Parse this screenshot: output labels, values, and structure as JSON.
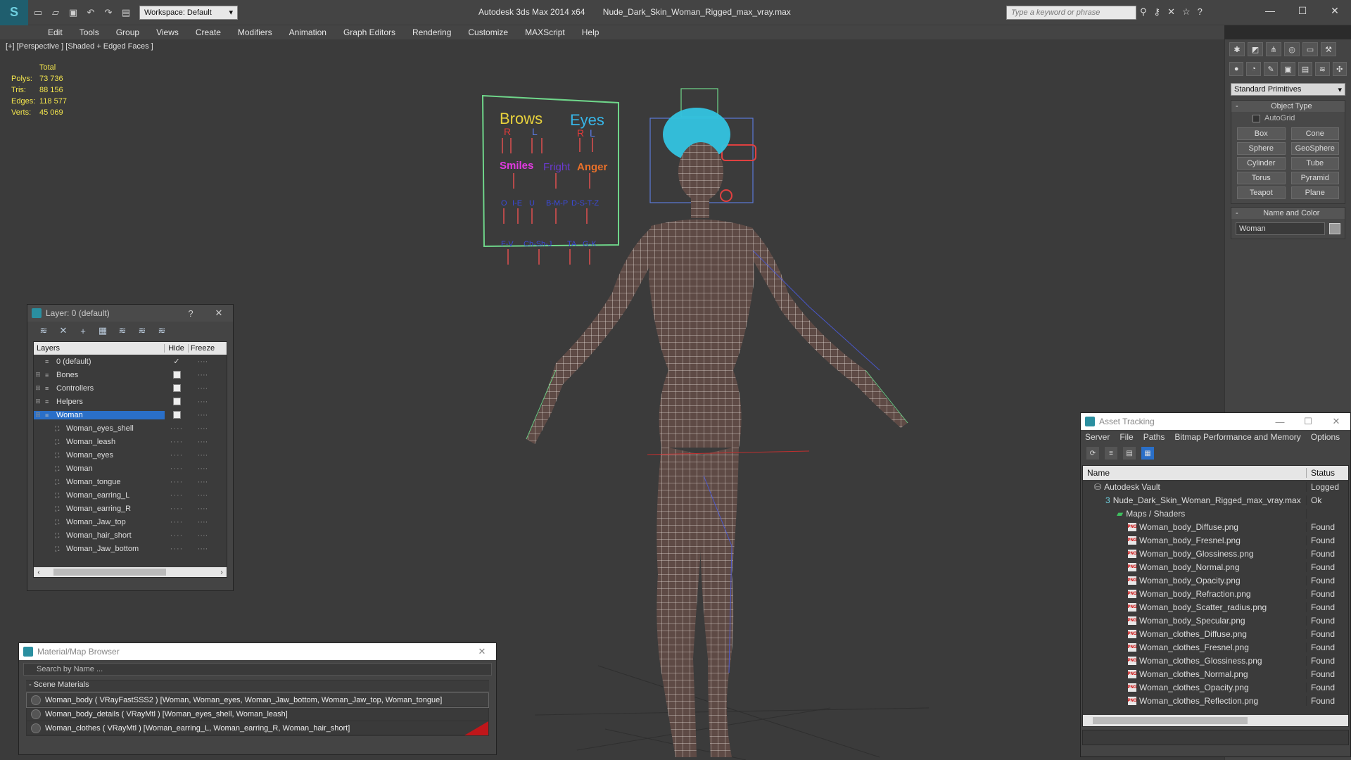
{
  "titlebar": {
    "workspace_label": "Workspace: Default",
    "app_title": "Autodesk 3ds Max  2014 x64",
    "file_title": "Nude_Dark_Skin_Woman_Rigged_max_vray.max",
    "search_placeholder": "Type a keyword or phrase"
  },
  "menu": [
    "Edit",
    "Tools",
    "Group",
    "Views",
    "Create",
    "Modifiers",
    "Animation",
    "Graph Editors",
    "Rendering",
    "Customize",
    "MAXScript",
    "Help"
  ],
  "viewport": {
    "label": "[+] [Perspective ] [Shaded + Edged Faces ]",
    "stats_header": "Total",
    "stats": [
      {
        "label": "Polys:",
        "value": "73 736"
      },
      {
        "label": "Tris:",
        "value": "88 156"
      },
      {
        "label": "Edges:",
        "value": "118 577"
      },
      {
        "label": "Verts:",
        "value": "45 069"
      }
    ],
    "face_rig": {
      "brows": "Brows",
      "eyes": "Eyes",
      "r": "R",
      "l": "L",
      "smiles": "Smiles",
      "fright": "Fright",
      "anger": "Anger",
      "row3": [
        "O",
        "I-E",
        "U",
        "B-M-P",
        "D-S-T-Z"
      ],
      "row4": [
        "F-V",
        "Ch-Sh-J",
        "TA",
        "G-K"
      ]
    },
    "colors": {
      "mesh": "#ffffff",
      "skin": "#5e4a45",
      "hair": "#33c3e0",
      "rig_green": "#6fd68a"
    }
  },
  "command_panel": {
    "dropdown": "Standard Primitives",
    "object_type_title": "Object Type",
    "autogrid": "AutoGrid",
    "buttons": [
      "Box",
      "Cone",
      "Sphere",
      "GeoSphere",
      "Cylinder",
      "Tube",
      "Torus",
      "Pyramid",
      "Teapot",
      "Plane"
    ],
    "name_color_title": "Name and Color",
    "name_value": "Woman"
  },
  "layer_panel": {
    "title": "Layer: 0 (default)",
    "help": "?",
    "col_layers": "Layers",
    "col_hide": "Hide",
    "col_freeze": "Freeze",
    "rows": [
      {
        "name": "0 (default)",
        "level": 0,
        "check": true
      },
      {
        "name": "Bones",
        "level": 0
      },
      {
        "name": "Controllers",
        "level": 0
      },
      {
        "name": "Helpers",
        "level": 0
      },
      {
        "name": "Woman",
        "level": 0,
        "selected": true
      },
      {
        "name": "Woman_eyes_shell",
        "level": 1
      },
      {
        "name": "Woman_leash",
        "level": 1
      },
      {
        "name": "Woman_eyes",
        "level": 1
      },
      {
        "name": "Woman",
        "level": 1
      },
      {
        "name": "Woman_tongue",
        "level": 1
      },
      {
        "name": "Woman_earring_L",
        "level": 1
      },
      {
        "name": "Woman_earring_R",
        "level": 1
      },
      {
        "name": "Woman_Jaw_top",
        "level": 1
      },
      {
        "name": "Woman_hair_short",
        "level": 1
      },
      {
        "name": "Woman_Jaw_bottom",
        "level": 1
      }
    ]
  },
  "material_browser": {
    "title": "Material/Map Browser",
    "search_placeholder": "Search by Name ...",
    "section": "- Scene Materials",
    "items": [
      "Woman_body  ( VRayFastSSS2 ) [Woman, Woman_eyes, Woman_Jaw_bottom, Woman_Jaw_top, Woman_tongue]",
      "Woman_body_details  ( VRayMtl ) [Woman_eyes_shell, Woman_leash]",
      "Woman_clothes  ( VRayMtl ) [Woman_earring_L, Woman_earring_R, Woman_hair_short]"
    ]
  },
  "asset_tracking": {
    "title": "Asset Tracking",
    "menu": [
      "Server",
      "File",
      "Paths",
      "Bitmap Performance and Memory",
      "Options"
    ],
    "col_name": "Name",
    "col_status": "Status",
    "rows": [
      {
        "name": "Autodesk Vault",
        "status": "Logged",
        "level": 1,
        "icon": "vault"
      },
      {
        "name": "Nude_Dark_Skin_Woman_Rigged_max_vray.max",
        "status": "Ok",
        "level": 2,
        "icon": "max"
      },
      {
        "name": "Maps / Shaders",
        "status": "",
        "level": 3,
        "icon": "folder"
      },
      {
        "name": "Woman_body_Diffuse.png",
        "status": "Found",
        "level": 4,
        "icon": "png"
      },
      {
        "name": "Woman_body_Fresnel.png",
        "status": "Found",
        "level": 4,
        "icon": "png"
      },
      {
        "name": "Woman_body_Glossiness.png",
        "status": "Found",
        "level": 4,
        "icon": "png"
      },
      {
        "name": "Woman_body_Normal.png",
        "status": "Found",
        "level": 4,
        "icon": "png"
      },
      {
        "name": "Woman_body_Opacity.png",
        "status": "Found",
        "level": 4,
        "icon": "png"
      },
      {
        "name": "Woman_body_Refraction.png",
        "status": "Found",
        "level": 4,
        "icon": "png"
      },
      {
        "name": "Woman_body_Scatter_radius.png",
        "status": "Found",
        "level": 4,
        "icon": "png"
      },
      {
        "name": "Woman_body_Specular.png",
        "status": "Found",
        "level": 4,
        "icon": "png"
      },
      {
        "name": "Woman_clothes_Diffuse.png",
        "status": "Found",
        "level": 4,
        "icon": "png"
      },
      {
        "name": "Woman_clothes_Fresnel.png",
        "status": "Found",
        "level": 4,
        "icon": "png"
      },
      {
        "name": "Woman_clothes_Glossiness.png",
        "status": "Found",
        "level": 4,
        "icon": "png"
      },
      {
        "name": "Woman_clothes_Normal.png",
        "status": "Found",
        "level": 4,
        "icon": "png"
      },
      {
        "name": "Woman_clothes_Opacity.png",
        "status": "Found",
        "level": 4,
        "icon": "png"
      },
      {
        "name": "Woman_clothes_Reflection.png",
        "status": "Found",
        "level": 4,
        "icon": "png"
      }
    ]
  }
}
